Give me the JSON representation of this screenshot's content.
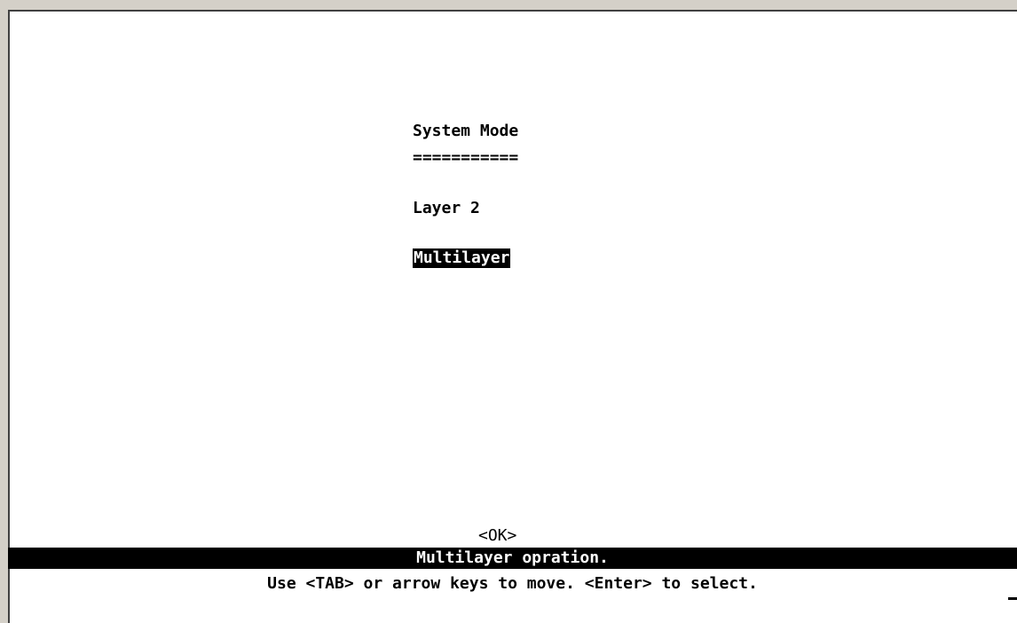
{
  "screen": {
    "title": "System Mode",
    "title_underline": "===========",
    "options": [
      {
        "label": "Layer 2",
        "selected": false
      },
      {
        "label": "Multilayer",
        "selected": true
      }
    ],
    "ok_label": "<OK>",
    "status_message": "Multilayer opration.",
    "help_text": "Use <TAB> or arrow keys to move. <Enter> to select."
  },
  "colors": {
    "background": "#ffffff",
    "foreground": "#000000",
    "highlight_bg": "#000000",
    "highlight_fg": "#ffffff",
    "frame": "#d4d0c8"
  }
}
